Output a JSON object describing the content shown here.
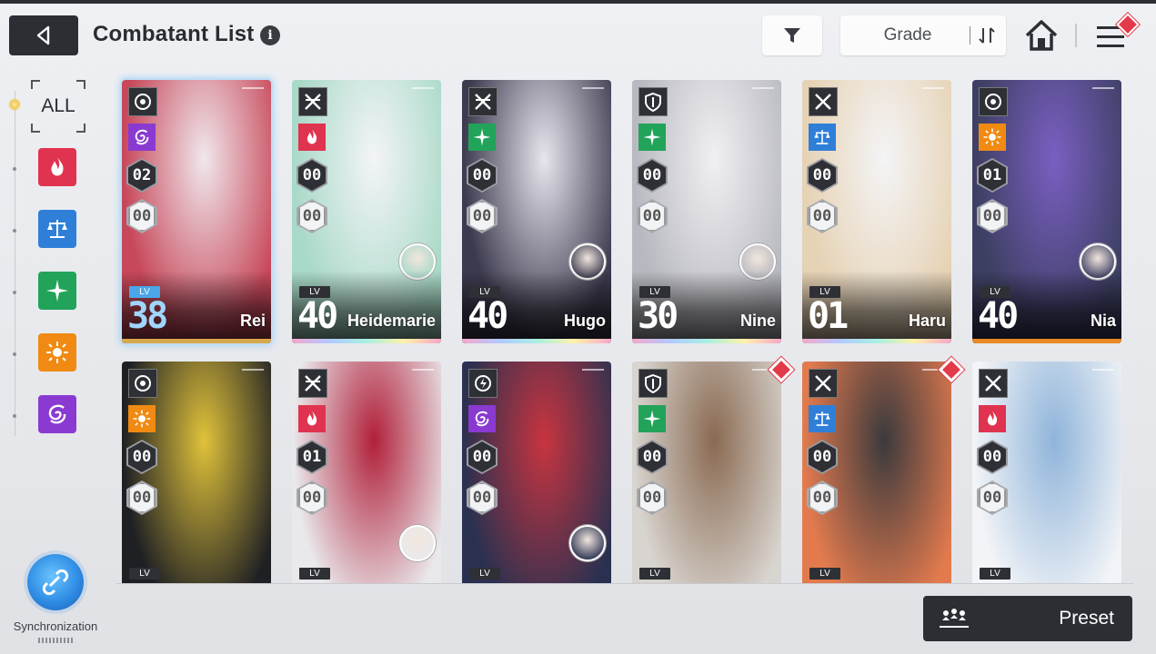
{
  "header": {
    "title": "Combatant List",
    "info_glyph": "i",
    "sort_label": "Grade",
    "icons": {
      "back": "back-arrow-icon",
      "filter": "funnel-icon",
      "sort": "sort-order-icon",
      "home": "home-icon",
      "menu": "hamburger-menu-icon"
    }
  },
  "sidebar": {
    "all_label": "ALL",
    "attributes": [
      {
        "name": "burst",
        "icon": "flame-attribute-icon",
        "color": "#e0334f"
      },
      {
        "name": "order",
        "icon": "scales-attribute-icon",
        "color": "#2f7fd8"
      },
      {
        "name": "electric",
        "icon": "star-attribute-icon",
        "color": "#22a35a"
      },
      {
        "name": "solar",
        "icon": "sun-attribute-icon",
        "color": "#f08a12"
      },
      {
        "name": "void",
        "icon": "vortex-attribute-icon",
        "color": "#8a3ad0"
      }
    ],
    "sync_label": "Synchronization"
  },
  "cards": [
    {
      "name": "Rei",
      "lv_label": "LV",
      "level": "38",
      "rank1": "02",
      "rank2": "00",
      "role": "target",
      "attr": "vortex",
      "selected": true,
      "has_avatar": false,
      "accent": "#d8a84c",
      "bg": [
        "#c7485a",
        "#f0e7ec"
      ]
    },
    {
      "name": "Heidemarie",
      "lv_label": "LV",
      "level": "40",
      "rank1": "00",
      "rank2": "00",
      "role": "swords",
      "attr": "flame",
      "selected": false,
      "has_avatar": true,
      "accent": "rainbow",
      "bg": [
        "#a9d9c8",
        "#f3f4f7"
      ]
    },
    {
      "name": "Hugo",
      "lv_label": "LV",
      "level": "40",
      "rank1": "00",
      "rank2": "00",
      "role": "swords",
      "attr": "star",
      "selected": false,
      "has_avatar": true,
      "accent": "rainbow",
      "bg": [
        "#3c3a4e",
        "#e7e6ee"
      ]
    },
    {
      "name": "Nine",
      "lv_label": "LV",
      "level": "30",
      "rank1": "00",
      "rank2": "00",
      "role": "shield",
      "attr": "star",
      "selected": false,
      "has_avatar": true,
      "accent": "rainbow",
      "bg": [
        "#b8b9c0",
        "#f0f0f3"
      ]
    },
    {
      "name": "Haru",
      "lv_label": "LV",
      "level": "01",
      "rank1": "00",
      "rank2": "00",
      "role": "crossed-swords",
      "attr": "scales",
      "selected": false,
      "has_avatar": false,
      "accent": "rainbow",
      "bg": [
        "#e6d2b4",
        "#f4f4f6"
      ]
    },
    {
      "name": "Nia",
      "lv_label": "LV",
      "level": "40",
      "rank1": "01",
      "rank2": "00",
      "role": "target",
      "attr": "sun",
      "selected": false,
      "has_avatar": true,
      "accent": "#e88a26",
      "bg": [
        "#3d3f62",
        "#7a5fc2"
      ]
    },
    {
      "name": "",
      "lv_label": "LV",
      "level": "",
      "rank1": "00",
      "rank2": "00",
      "role": "target",
      "attr": "sun",
      "selected": false,
      "has_avatar": false,
      "new": false,
      "bg": [
        "#1f2024",
        "#e0c23a"
      ]
    },
    {
      "name": "",
      "lv_label": "LV",
      "level": "",
      "rank1": "01",
      "rank2": "00",
      "role": "swords",
      "attr": "flame",
      "selected": false,
      "has_avatar": true,
      "new": false,
      "bg": [
        "#e9e9ec",
        "#b1203a"
      ]
    },
    {
      "name": "",
      "lv_label": "LV",
      "level": "",
      "rank1": "00",
      "rank2": "00",
      "role": "bolt",
      "attr": "vortex",
      "selected": false,
      "has_avatar": true,
      "new": false,
      "bg": [
        "#2a3150",
        "#c8343f"
      ]
    },
    {
      "name": "",
      "lv_label": "LV",
      "level": "",
      "rank1": "00",
      "rank2": "00",
      "role": "shield",
      "attr": "star",
      "selected": false,
      "has_avatar": false,
      "new": true,
      "bg": [
        "#d8d4cf",
        "#8a6a52"
      ]
    },
    {
      "name": "",
      "lv_label": "LV",
      "level": "",
      "rank1": "00",
      "rank2": "00",
      "role": "crossed-swords",
      "attr": "scales",
      "selected": false,
      "has_avatar": false,
      "new": true,
      "bg": [
        "#e27a4e",
        "#3b3a3d"
      ]
    },
    {
      "name": "",
      "lv_label": "LV",
      "level": "",
      "rank1": "00",
      "rank2": "00",
      "role": "crossed-swords",
      "attr": "flame",
      "selected": false,
      "has_avatar": false,
      "new": false,
      "bg": [
        "#f2f4f7",
        "#8fb4da"
      ]
    }
  ],
  "footer": {
    "preset_label": "Preset",
    "preset_icon": "team-preset-icon"
  }
}
